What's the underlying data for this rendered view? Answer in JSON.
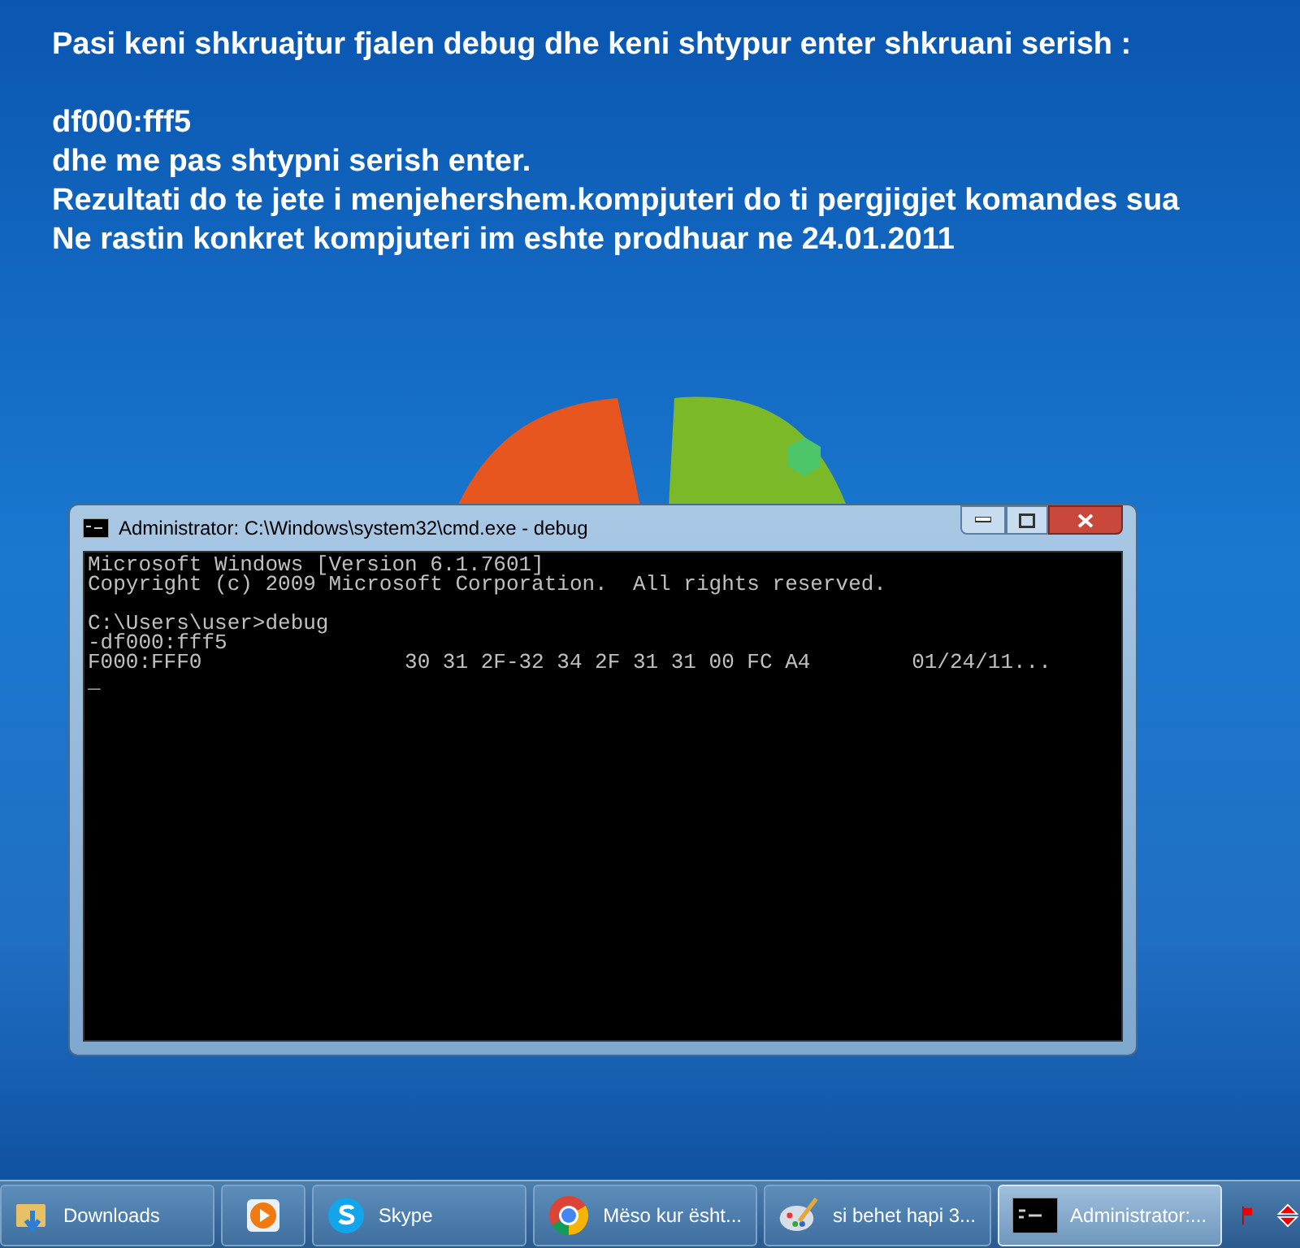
{
  "caption": {
    "lines": [
      "Pasi keni shkruajtur fjalen debug dhe keni shtypur enter shkruani serish :",
      "df000:fff5",
      "dhe me pas shtypni serish enter.",
      "Rezultati do te jete i menjehershem.kompjuteri do ti pergjigjet komandes sua",
      "Ne rastin konkret kompjuteri im eshte prodhuar ne 24.01.2011"
    ]
  },
  "console_window": {
    "title": "Administrator: C:\\Windows\\system32\\cmd.exe - debug",
    "blocks": [
      [
        "Microsoft Windows [Version 6.1.7601]",
        "Copyright (c) 2009 Microsoft Corporation.  All rights reserved."
      ],
      [
        "C:\\Users\\user>debug",
        "-df000:fff5",
        "F000:FFF0                30 31 2F-32 34 2F 31 31 00 FC A4        01/24/11...",
        "_"
      ]
    ]
  },
  "taskbar": {
    "items": [
      {
        "kind": "folder",
        "label": "Downloads",
        "selected": false
      },
      {
        "kind": "media",
        "selected": false
      },
      {
        "kind": "skype",
        "label": "Skype",
        "selected": false
      },
      {
        "kind": "chrome",
        "label": "Mëso kur ësht...",
        "selected": false
      },
      {
        "kind": "paint",
        "label": "si behet hapi 3...",
        "selected": false
      },
      {
        "kind": "console",
        "label": "Administrator:...",
        "selected": true
      }
    ]
  }
}
